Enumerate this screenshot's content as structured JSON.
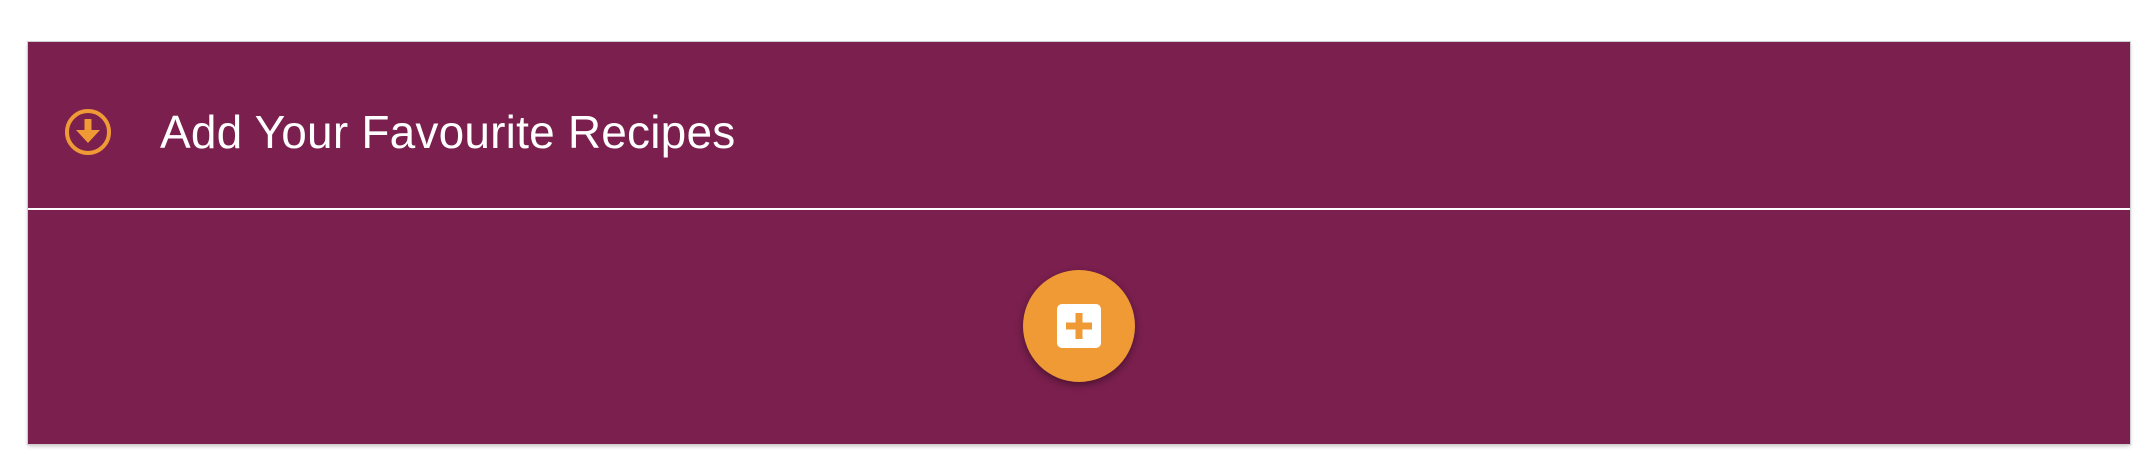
{
  "accordion": {
    "title": "Add Your Favourite Recipes",
    "expand_icon": "arrow-circle-down-icon",
    "expanded": true
  },
  "actions": {
    "add_recipe_icon": "plus-square-icon"
  },
  "colors": {
    "panel_background": "#7b1f4e",
    "accent": "#f09a35",
    "title_text": "#ffffff"
  }
}
